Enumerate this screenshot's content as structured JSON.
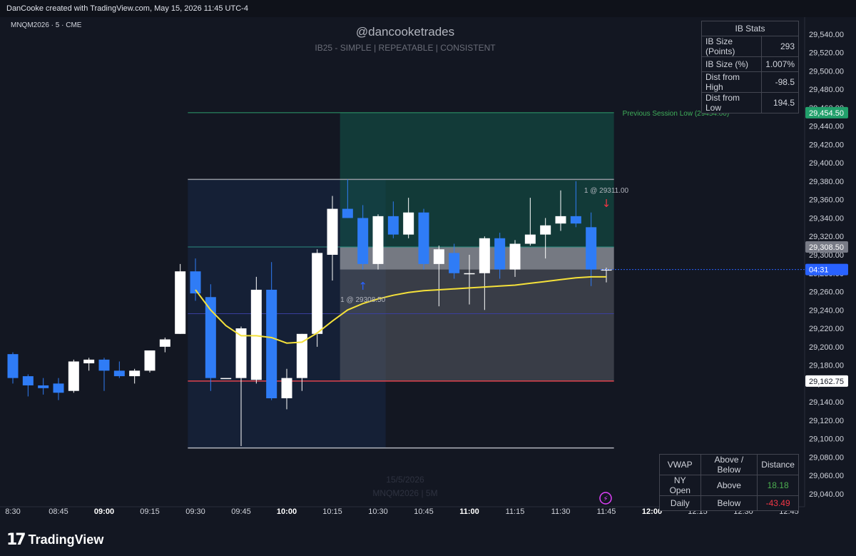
{
  "header": {
    "attribution": "DanCooke created with TradingView.com, May 15, 2026 11:45 UTC-4"
  },
  "symbol_label": "MNQM2026 · 5 · CME",
  "watermark": {
    "title": "@dancooketrades",
    "subtitle": "IB25  -  SIMPLE  |  REPEATABLE  |  CONSISTENT",
    "date": "15/5/2026",
    "symbol": "MNQM2026 | 5M"
  },
  "ib_stats": {
    "title": "IB Stats",
    "rows": [
      {
        "label": "IB Size (Points)",
        "value": "293"
      },
      {
        "label": "IB Size (%)",
        "value": "1.007%"
      },
      {
        "label": "Dist from High",
        "value": "-98.5"
      },
      {
        "label": "Dist from Low",
        "value": "194.5"
      }
    ]
  },
  "vwap_table": {
    "headers": [
      "VWAP",
      "Above / Below",
      "Distance"
    ],
    "rows": [
      {
        "label": "NY Open",
        "state": "Above",
        "distance": "18.18"
      },
      {
        "label": "Daily",
        "state": "Below",
        "distance": "-43.49"
      }
    ]
  },
  "branding": {
    "logo_text": "TradingView",
    "logo_mark": "17"
  },
  "colors": {
    "background": "#131722",
    "bull": "#ffffff",
    "bear": "#2f7cf6",
    "vwap": "#f5e13a",
    "session_low": "#2e9e6e",
    "ib_low": "#e0434e",
    "accent_blue": "#2962ff"
  },
  "chart_data": {
    "type": "candlestick",
    "symbol": "MNQM2026",
    "interval": "5",
    "ylim": [
      29030,
      29550
    ],
    "y_ticks": [
      29040,
      29060,
      29080,
      29100,
      29120,
      29140,
      29160,
      29180,
      29200,
      29220,
      29240,
      29260,
      29280,
      29300,
      29320,
      29340,
      29360,
      29380,
      29400,
      29420,
      29440,
      29460,
      29480,
      29500,
      29520,
      29540
    ],
    "x_ticks": [
      {
        "label": "8:30",
        "bold": false
      },
      {
        "label": "08:45",
        "bold": false
      },
      {
        "label": "09:00",
        "bold": true
      },
      {
        "label": "09:15",
        "bold": false
      },
      {
        "label": "09:30",
        "bold": false
      },
      {
        "label": "09:45",
        "bold": false
      },
      {
        "label": "10:00",
        "bold": true
      },
      {
        "label": "10:15",
        "bold": false
      },
      {
        "label": "10:30",
        "bold": false
      },
      {
        "label": "10:45",
        "bold": false
      },
      {
        "label": "11:00",
        "bold": true
      },
      {
        "label": "11:15",
        "bold": false
      },
      {
        "label": "11:30",
        "bold": false
      },
      {
        "label": "11:45",
        "bold": false
      },
      {
        "label": "12:00",
        "bold": true
      },
      {
        "label": "12:15",
        "bold": false
      },
      {
        "label": "12:30",
        "bold": false
      },
      {
        "label": "12:45",
        "bold": false
      }
    ],
    "candles": [
      {
        "t": "08:30",
        "o": 29192,
        "h": 29194,
        "l": 29160,
        "c": 29166
      },
      {
        "t": "08:35",
        "o": 29168,
        "h": 29170,
        "l": 29146,
        "c": 29158
      },
      {
        "t": "08:40",
        "o": 29158,
        "h": 29166,
        "l": 29148,
        "c": 29155
      },
      {
        "t": "08:45",
        "o": 29160,
        "h": 29166,
        "l": 29142,
        "c": 29150
      },
      {
        "t": "08:50",
        "o": 29152,
        "h": 29186,
        "l": 29150,
        "c": 29184
      },
      {
        "t": "08:55",
        "o": 29182,
        "h": 29188,
        "l": 29174,
        "c": 29186
      },
      {
        "t": "09:00",
        "o": 29186,
        "h": 29188,
        "l": 29152,
        "c": 29174
      },
      {
        "t": "09:05",
        "o": 29174,
        "h": 29184,
        "l": 29166,
        "c": 29168
      },
      {
        "t": "09:10",
        "o": 29168,
        "h": 29176,
        "l": 29160,
        "c": 29174
      },
      {
        "t": "09:15",
        "o": 29174,
        "h": 29196,
        "l": 29172,
        "c": 29196
      },
      {
        "t": "09:20",
        "o": 29200,
        "h": 29210,
        "l": 29194,
        "c": 29208
      },
      {
        "t": "09:25",
        "o": 29214,
        "h": 29290,
        "l": 29214,
        "c": 29282
      },
      {
        "t": "09:30",
        "o": 29282,
        "h": 29296,
        "l": 29250,
        "c": 29258
      },
      {
        "t": "09:35",
        "o": 29254,
        "h": 29268,
        "l": 29152,
        "c": 29166
      },
      {
        "t": "09:40",
        "o": 29166,
        "h": 29166,
        "l": 29166,
        "c": 29166
      },
      {
        "t": "09:45",
        "o": 29166,
        "h": 29222,
        "l": 29092,
        "c": 29220
      },
      {
        "t": "09:50",
        "o": 29164,
        "h": 29276,
        "l": 29160,
        "c": 29262
      },
      {
        "t": "09:55",
        "o": 29262,
        "h": 29292,
        "l": 29142,
        "c": 29144
      },
      {
        "t": "10:00",
        "o": 29144,
        "h": 29176,
        "l": 29132,
        "c": 29166
      },
      {
        "t": "10:05",
        "o": 29166,
        "h": 29214,
        "l": 29152,
        "c": 29214
      },
      {
        "t": "10:10",
        "o": 29214,
        "h": 29306,
        "l": 29200,
        "c": 29302
      },
      {
        "t": "10:15",
        "o": 29300,
        "h": 29364,
        "l": 29272,
        "c": 29350
      },
      {
        "t": "10:20",
        "o": 29350,
        "h": 29382,
        "l": 29340,
        "c": 29340
      },
      {
        "t": "10:25",
        "o": 29340,
        "h": 29354,
        "l": 29284,
        "c": 29290
      },
      {
        "t": "10:30",
        "o": 29290,
        "h": 29344,
        "l": 29284,
        "c": 29342
      },
      {
        "t": "10:35",
        "o": 29342,
        "h": 29358,
        "l": 29318,
        "c": 29322
      },
      {
        "t": "10:40",
        "o": 29322,
        "h": 29362,
        "l": 29318,
        "c": 29346
      },
      {
        "t": "10:45",
        "o": 29346,
        "h": 29350,
        "l": 29284,
        "c": 29290
      },
      {
        "t": "10:50",
        "o": 29290,
        "h": 29310,
        "l": 29244,
        "c": 29306
      },
      {
        "t": "10:55",
        "o": 29302,
        "h": 29312,
        "l": 29274,
        "c": 29280
      },
      {
        "t": "11:00",
        "o": 29280,
        "h": 29300,
        "l": 29246,
        "c": 29280
      },
      {
        "t": "11:05",
        "o": 29280,
        "h": 29320,
        "l": 29240,
        "c": 29318
      },
      {
        "t": "11:10",
        "o": 29318,
        "h": 29324,
        "l": 29274,
        "c": 29284
      },
      {
        "t": "11:15",
        "o": 29284,
        "h": 29316,
        "l": 29276,
        "c": 29312
      },
      {
        "t": "11:20",
        "o": 29312,
        "h": 29362,
        "l": 29310,
        "c": 29322
      },
      {
        "t": "11:25",
        "o": 29322,
        "h": 29340,
        "l": 29296,
        "c": 29332
      },
      {
        "t": "11:30",
        "o": 29334,
        "h": 29370,
        "l": 29326,
        "c": 29342
      },
      {
        "t": "11:35",
        "o": 29342,
        "h": 29380,
        "l": 29330,
        "c": 29334
      },
      {
        "t": "11:40",
        "o": 29330,
        "h": 29346,
        "l": 29266,
        "c": 29284
      },
      {
        "t": "11:45",
        "o": 29284,
        "h": 29286,
        "l": 29270,
        "c": 29284
      }
    ],
    "vwap": [
      {
        "t": "09:30",
        "v": 29262
      },
      {
        "t": "09:35",
        "v": 29240
      },
      {
        "t": "09:40",
        "v": 29223
      },
      {
        "t": "09:45",
        "v": 29212
      },
      {
        "t": "09:50",
        "v": 29212
      },
      {
        "t": "09:55",
        "v": 29210
      },
      {
        "t": "10:00",
        "v": 29204
      },
      {
        "t": "10:05",
        "v": 29205
      },
      {
        "t": "10:10",
        "v": 29215
      },
      {
        "t": "10:15",
        "v": 29228
      },
      {
        "t": "10:20",
        "v": 29240
      },
      {
        "t": "10:25",
        "v": 29247
      },
      {
        "t": "10:30",
        "v": 29252
      },
      {
        "t": "10:35",
        "v": 29256
      },
      {
        "t": "10:40",
        "v": 29259
      },
      {
        "t": "10:45",
        "v": 29261
      },
      {
        "t": "10:50",
        "v": 29262
      },
      {
        "t": "10:55",
        "v": 29263
      },
      {
        "t": "11:00",
        "v": 29264
      },
      {
        "t": "11:05",
        "v": 29265
      },
      {
        "t": "11:10",
        "v": 29266
      },
      {
        "t": "11:15",
        "v": 29267
      },
      {
        "t": "11:20",
        "v": 29269
      },
      {
        "t": "11:25",
        "v": 29271
      },
      {
        "t": "11:30",
        "v": 29273
      },
      {
        "t": "11:35",
        "v": 29275
      },
      {
        "t": "11:40",
        "v": 29276
      },
      {
        "t": "11:45",
        "v": 29276
      }
    ],
    "levels": {
      "previous_session_low": {
        "price": 29454.5,
        "label": "Previous Session Low (29454.00)"
      },
      "ib_high": 29382,
      "ib_mid": 29308.5,
      "ib_low": 29162.75,
      "ib_lower": 29236,
      "range_low": 29090
    },
    "trades": [
      {
        "t": "10:25",
        "side": "buy",
        "label": "1 @ 29308.50",
        "price": 29308.5
      },
      {
        "t": "11:40",
        "side": "sell",
        "label": "1 @ 29311.00",
        "price": 29311
      }
    ],
    "price_badges": [
      {
        "text": "29,454.50",
        "value": 29454.5,
        "kind": "session_low"
      },
      {
        "text": "29,308.50",
        "value": 29308.5,
        "kind": "mid"
      },
      {
        "text": "04:31",
        "value": 29284,
        "kind": "current"
      },
      {
        "text": "29,162.75",
        "value": 29162.75,
        "kind": "ib_low"
      }
    ]
  }
}
